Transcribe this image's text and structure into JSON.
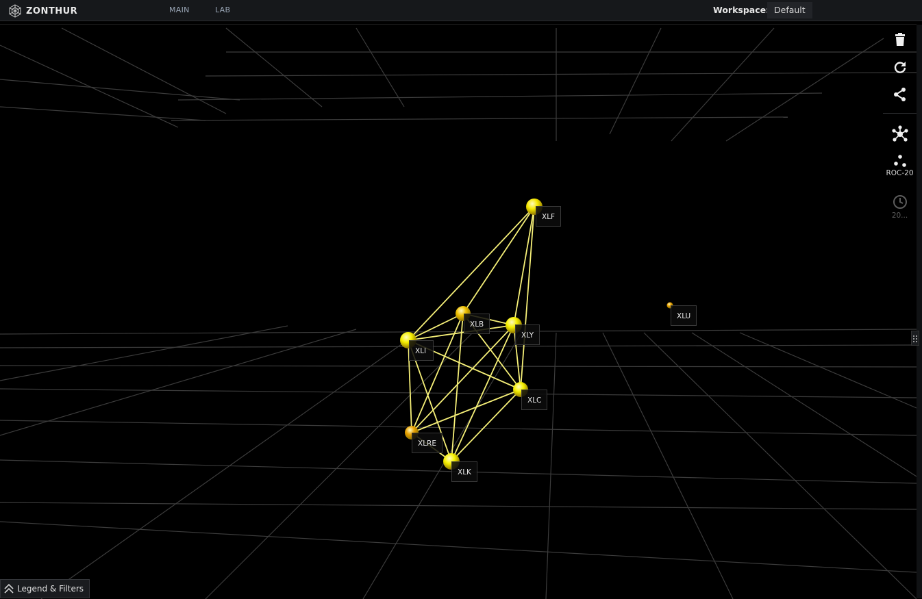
{
  "app": {
    "name": "ZONTHUR"
  },
  "nav": [
    {
      "label": "MAIN"
    },
    {
      "label": "LAB"
    }
  ],
  "workspace": {
    "label": "Workspace:",
    "value": "Default"
  },
  "toolbar": {
    "items": [
      {
        "icon": "trash-icon"
      },
      {
        "icon": "refresh-icon"
      },
      {
        "icon": "share-icon"
      },
      {
        "icon": "network-layout-icon"
      },
      {
        "icon": "cluster-icon",
        "caption": "ROC-20"
      },
      {
        "icon": "clock-icon",
        "caption": "20..."
      }
    ]
  },
  "graph": {
    "node_color": "#f5f000",
    "node_alt_color": "#e8a000",
    "edge_color": "#f6f078",
    "nodes": [
      {
        "id": "XLF",
        "label": "XLF",
        "color": "#f5e800"
      },
      {
        "id": "XLB",
        "label": "XLB",
        "color": "#f0c000"
      },
      {
        "id": "XLY",
        "label": "XLY",
        "color": "#f5f000"
      },
      {
        "id": "XLI",
        "label": "XLI",
        "color": "#f5f000"
      },
      {
        "id": "XLC",
        "label": "XLC",
        "color": "#f5f000"
      },
      {
        "id": "XLRE",
        "label": "XLRE",
        "color": "#e8a000"
      },
      {
        "id": "XLK",
        "label": "XLK",
        "color": "#f5f000"
      },
      {
        "id": "XLU",
        "label": "XLU",
        "color": "#e8a000"
      }
    ],
    "edges": [
      [
        "XLF",
        "XLI"
      ],
      [
        "XLF",
        "XLB"
      ],
      [
        "XLF",
        "XLY"
      ],
      [
        "XLF",
        "XLC"
      ],
      [
        "XLI",
        "XLB"
      ],
      [
        "XLI",
        "XLY"
      ],
      [
        "XLI",
        "XLC"
      ],
      [
        "XLI",
        "XLRE"
      ],
      [
        "XLI",
        "XLK"
      ],
      [
        "XLB",
        "XLY"
      ],
      [
        "XLB",
        "XLC"
      ],
      [
        "XLB",
        "XLRE"
      ],
      [
        "XLB",
        "XLK"
      ],
      [
        "XLY",
        "XLC"
      ],
      [
        "XLY",
        "XLRE"
      ],
      [
        "XLY",
        "XLK"
      ],
      [
        "XLC",
        "XLRE"
      ],
      [
        "XLC",
        "XLK"
      ],
      [
        "XLRE",
        "XLK"
      ]
    ]
  },
  "legend": {
    "label": "Legend & Filters"
  }
}
